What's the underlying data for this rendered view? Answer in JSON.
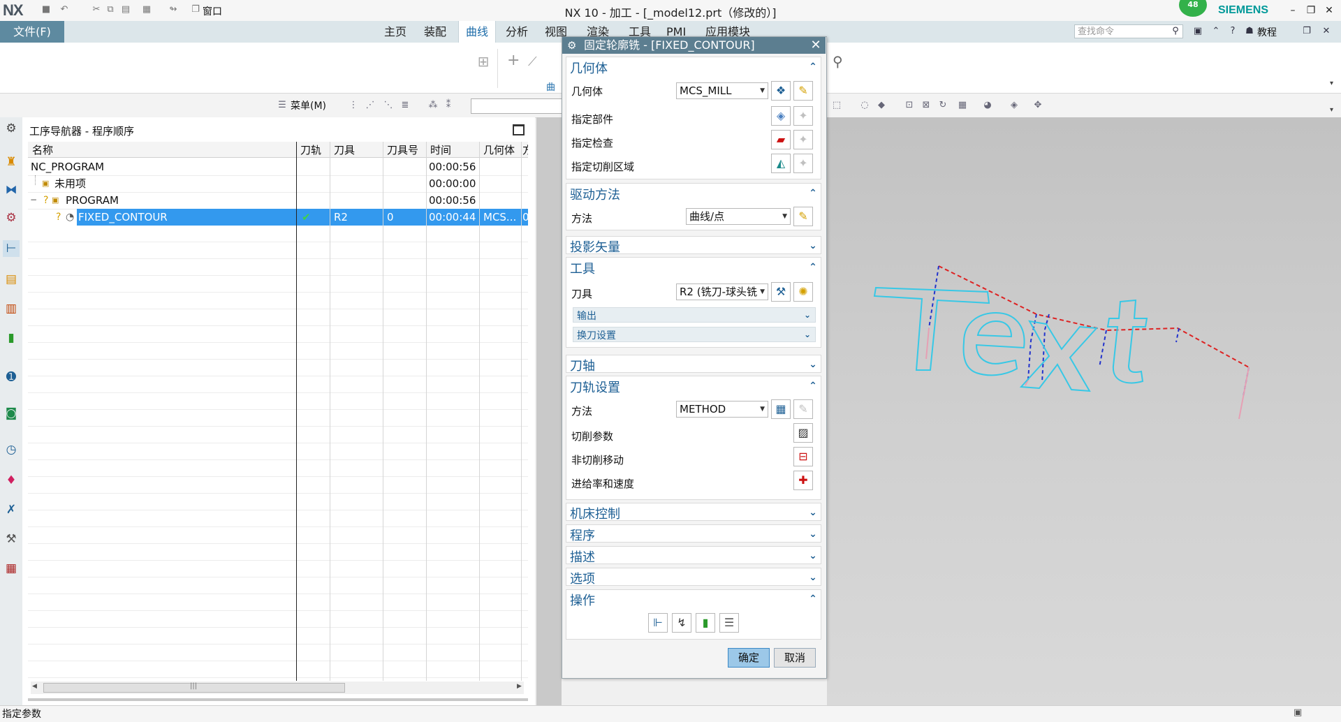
{
  "app": {
    "logo": "NX",
    "title": "NX 10 - 加工 - [_model12.prt（修改的）]",
    "brand": "SIEMENS",
    "notification_count": "48",
    "quick_access": {
      "window_label": "窗口"
    }
  },
  "ribbon": {
    "file_label": "文件(F)",
    "tabs": [
      {
        "label": "主页",
        "active": false
      },
      {
        "label": "装配",
        "active": false
      },
      {
        "label": "曲线",
        "active": true
      },
      {
        "label": "分析",
        "active": false
      },
      {
        "label": "视图",
        "active": false
      },
      {
        "label": "渲染",
        "active": false
      },
      {
        "label": "工具",
        "active": false
      },
      {
        "label": "PMI",
        "active": false
      },
      {
        "label": "应用模块",
        "active": false
      }
    ],
    "search_placeholder": "查找命令",
    "tutorial_label": "教程",
    "group_label": "曲"
  },
  "toolbar": {
    "menu_label": "菜单(M)"
  },
  "navigator": {
    "title": "工序导航器 - 程序顺序",
    "columns": [
      "名称",
      "刀轨",
      "刀具",
      "刀具号",
      "时间",
      "几何体",
      "方"
    ],
    "rows": [
      {
        "name": "NC_PROGRAM",
        "path": "",
        "tool": "",
        "tool_no": "",
        "time": "00:00:56",
        "geometry": "",
        "method": ""
      },
      {
        "name": "未用项",
        "path": "",
        "tool": "",
        "tool_no": "",
        "time": "00:00:00",
        "geometry": "",
        "method": ""
      },
      {
        "name": "PROGRAM",
        "path": "",
        "tool": "",
        "tool_no": "",
        "time": "00:00:56",
        "geometry": "",
        "method": ""
      },
      {
        "name": "FIXED_CONTOUR",
        "path": "✔",
        "tool": "R2",
        "tool_no": "0",
        "time": "00:00:44",
        "geometry": "MCS...",
        "method": "0"
      }
    ],
    "scroll_grip": "|||"
  },
  "dialog": {
    "title": "固定轮廓铣 - [FIXED_CONTOUR]",
    "sections": {
      "geometry": {
        "header": "几何体",
        "geometry_label": "几何体",
        "geometry_value": "MCS_MILL",
        "part_label": "指定部件",
        "check_label": "指定检查",
        "cut_area_label": "指定切削区域"
      },
      "drive": {
        "header": "驱动方法",
        "method_label": "方法",
        "method_value": "曲线/点"
      },
      "projection": {
        "header": "投影矢量"
      },
      "tool": {
        "header": "工具",
        "tool_label": "刀具",
        "tool_value": "R2 (铣刀-球头铣",
        "output_label": "输出",
        "tool_change_label": "换刀设置"
      },
      "axis": {
        "header": "刀轴"
      },
      "path_settings": {
        "header": "刀轨设置",
        "method_label": "方法",
        "method_value": "METHOD",
        "cut_params_label": "切削参数",
        "non_cut_label": "非切削移动",
        "feeds_label": "进给率和速度"
      },
      "machine": {
        "header": "机床控制"
      },
      "program": {
        "header": "程序"
      },
      "description": {
        "header": "描述"
      },
      "options": {
        "header": "选项"
      },
      "actions": {
        "header": "操作"
      }
    },
    "ok_label": "确定",
    "cancel_label": "取消"
  },
  "status": {
    "text": "指定参数"
  },
  "colors": {
    "accent": "#1d5f94",
    "selection": "#3399ee",
    "toolpath_cyan": "#37c8e6",
    "toolpath_red_dashed": "#dd2222",
    "toolpath_blue_dashed": "#2233cc",
    "file_tab": "#5e8aa0"
  }
}
